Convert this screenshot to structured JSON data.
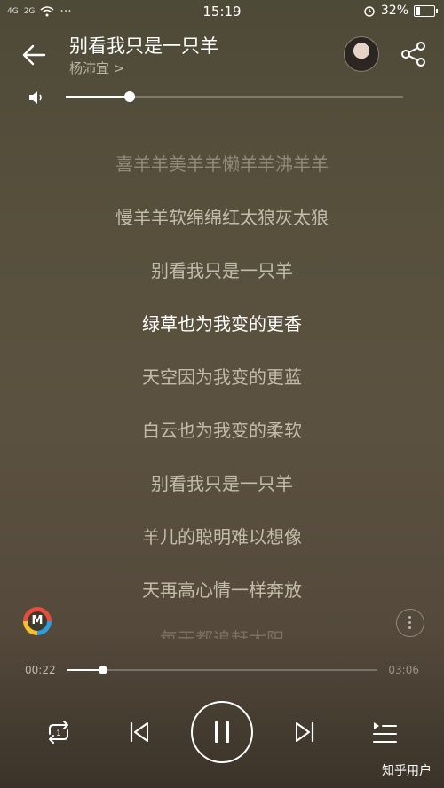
{
  "status": {
    "signal_a": "4G",
    "signal_b": "2G",
    "dots": "···",
    "time": "15:19",
    "battery": "32%",
    "battery_fraction": 0.32
  },
  "header": {
    "title": "别看我只是一只羊",
    "artist": "杨沛宜 >"
  },
  "volume": {
    "level": 0.19
  },
  "lyrics": [
    "喜羊羊美羊羊懒羊羊沸羊羊",
    "慢羊羊软绵绵红太狼灰太狼",
    "别看我只是一只羊",
    "绿草也为我变的更香",
    "天空因为我变的更蓝",
    "白云也为我变的柔软",
    "别看我只是一只羊",
    "羊儿的聪明难以想像",
    "天再高心情一样奔放"
  ],
  "current_lyric_index": 3,
  "lyric_partial": "每天都追赶太阳",
  "app_logo": "M",
  "progress": {
    "elapsed": "00:22",
    "total": "03:06",
    "fraction": 0.118
  },
  "watermark": "知乎用户",
  "icons": {
    "back": "arrow-left-icon",
    "share": "share-icon",
    "volume": "speaker-icon",
    "repeat": "repeat-one-icon",
    "prev": "skip-previous-icon",
    "pause": "pause-icon",
    "next": "skip-next-icon",
    "playlist": "playlist-icon",
    "more": "more-vertical-icon"
  }
}
